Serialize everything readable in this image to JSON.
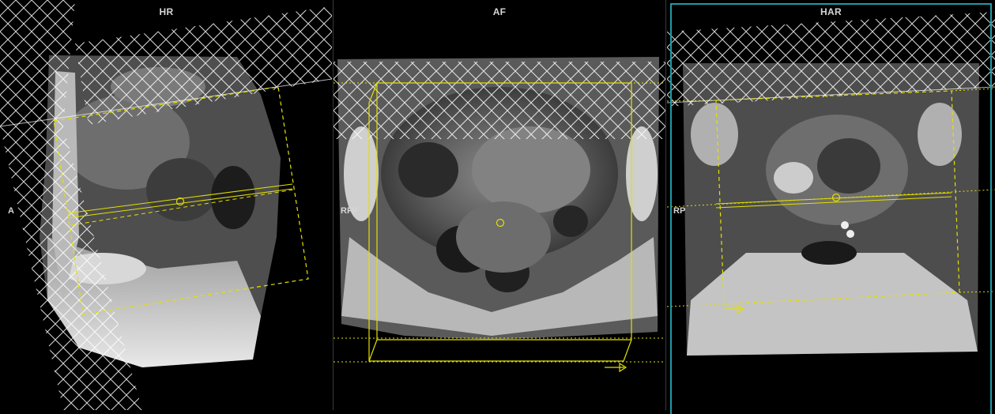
{
  "viewports": [
    {
      "id": "sagittal",
      "title": "HR",
      "orientation_left": "A"
    },
    {
      "id": "axial",
      "title": "AF",
      "orientation_left": "RFP"
    },
    {
      "id": "coronal",
      "title": "HAR",
      "orientation_left": "RP"
    }
  ],
  "colors": {
    "background": "#000000",
    "planning_box": "#e3e000",
    "saturation_band": "#ffffff",
    "active_viewport_border": "#1f9aa6",
    "label_text": "#d6d6d6"
  },
  "active_viewport": "coronal",
  "icons": [
    "center-handle-icon",
    "phase-direction-arrow-icon"
  ]
}
